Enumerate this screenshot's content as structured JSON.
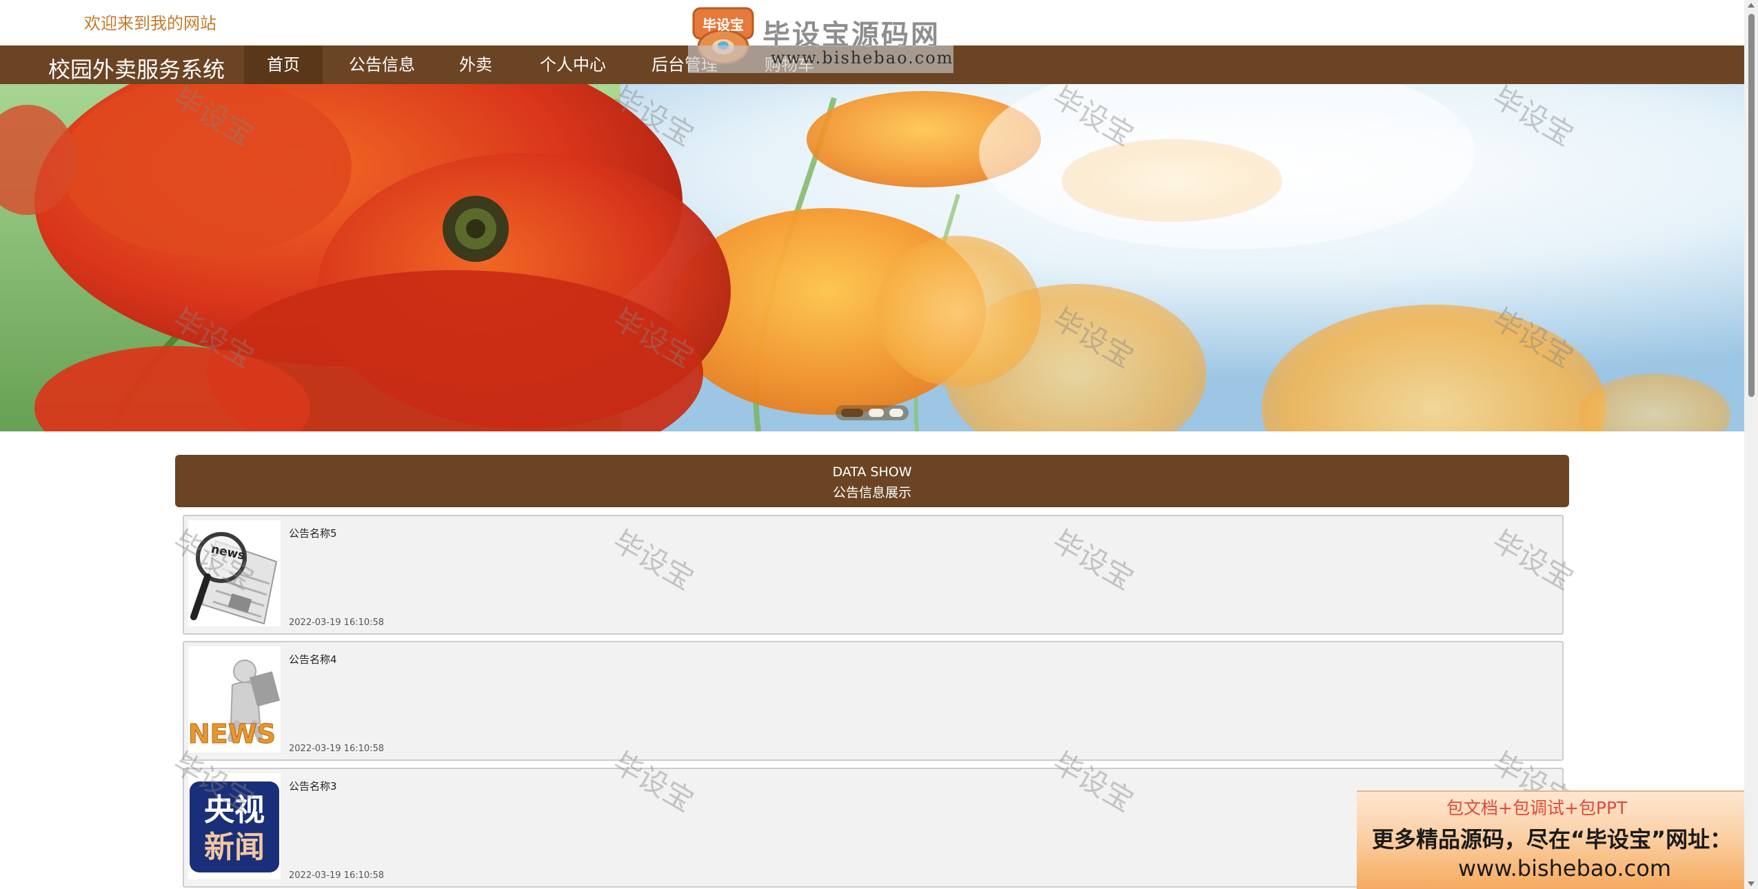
{
  "topbar": {
    "welcome": "欢迎来到我的网站"
  },
  "logo": {
    "badge_text": "毕设宝",
    "title": "毕设宝源码网",
    "url": "www.bishebao.com"
  },
  "nav": {
    "brand": "校园外卖服务系统",
    "items": [
      {
        "label": "首页",
        "active": true
      },
      {
        "label": "公告信息",
        "active": false
      },
      {
        "label": "外卖",
        "active": false
      },
      {
        "label": "个人中心",
        "active": false
      },
      {
        "label": "后台管理",
        "active": false
      },
      {
        "label": "购物车",
        "active": false
      }
    ]
  },
  "carousel": {
    "slide_count": 3,
    "active_index": 0
  },
  "section": {
    "title_en": "DATA SHOW",
    "title_cn": "公告信息展示"
  },
  "notices": [
    {
      "title": "公告名称5",
      "time": "2022-03-19 16:10:58",
      "image": "news-magnifier-image"
    },
    {
      "title": "公告名称4",
      "time": "2022-03-19 16:10:58",
      "image": "news-figure-image"
    },
    {
      "title": "公告名称3",
      "time": "2022-03-19 16:10:58",
      "image": "cctv-news-image",
      "image_text": {
        "line1": "央视",
        "line2": "新闻"
      }
    }
  ],
  "thumbs": {
    "news_word": "news",
    "news_big": "NEWS"
  },
  "promo": {
    "line1": "包文档+包调试+包PPT",
    "line2": "更多精品源码，尽在“毕设宝”网址：",
    "line3": "www.bishebao.com"
  },
  "watermark": {
    "text": "毕设宝"
  },
  "colors": {
    "nav_bg": "#6b4424",
    "nav_active_bg": "#5a3719",
    "welcome_text": "#c57a2a",
    "card_bg": "#f2f2f2",
    "promo_red": "#e04a3a"
  }
}
